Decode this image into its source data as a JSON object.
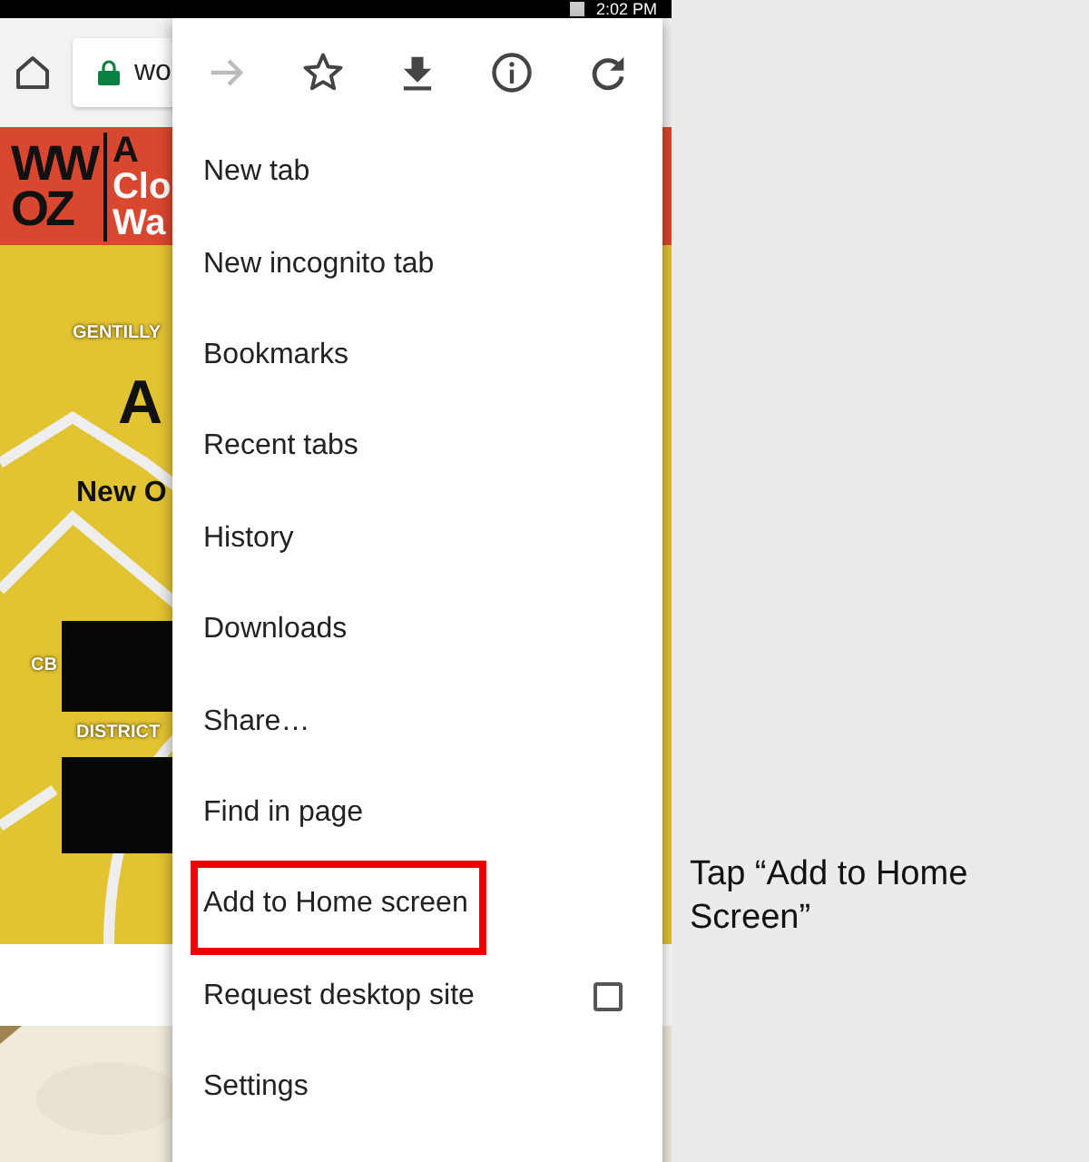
{
  "status_bar": {
    "time": "2:02 PM"
  },
  "toolbar": {
    "address": "wo",
    "secure": true
  },
  "site": {
    "logo_top": "WW",
    "logo_bottom": "OZ",
    "header_lines": [
      "A",
      "Clo",
      "Wa"
    ],
    "poster_texts": [
      {
        "text": "GENTILLY",
        "kind": "label"
      },
      {
        "text": "A",
        "kind": "headline"
      },
      {
        "text": "New O",
        "kind": "subhead"
      },
      {
        "text": "CB",
        "kind": "label"
      },
      {
        "text": "DISTRICT",
        "kind": "label"
      }
    ]
  },
  "menu": {
    "icons": [
      {
        "kind": "forward",
        "disabled": true
      },
      {
        "kind": "star",
        "disabled": false
      },
      {
        "kind": "download",
        "disabled": false
      },
      {
        "kind": "info",
        "disabled": false
      },
      {
        "kind": "reload",
        "disabled": false
      }
    ],
    "items": [
      {
        "label": "New tab",
        "highlighted": false
      },
      {
        "label": "New incognito tab",
        "highlighted": false
      },
      {
        "label": "Bookmarks",
        "highlighted": false
      },
      {
        "label": "Recent tabs",
        "highlighted": false
      },
      {
        "label": "History",
        "highlighted": false
      },
      {
        "label": "Downloads",
        "highlighted": false
      },
      {
        "label": "Share…",
        "highlighted": false
      },
      {
        "label": "Find in page",
        "highlighted": false
      },
      {
        "label": "Add to Home screen",
        "highlighted": true
      },
      {
        "label": "Request desktop site",
        "highlighted": false,
        "checked": false
      },
      {
        "label": "Settings",
        "highlighted": false
      }
    ]
  },
  "caption": "Tap “Add to Home Screen”"
}
